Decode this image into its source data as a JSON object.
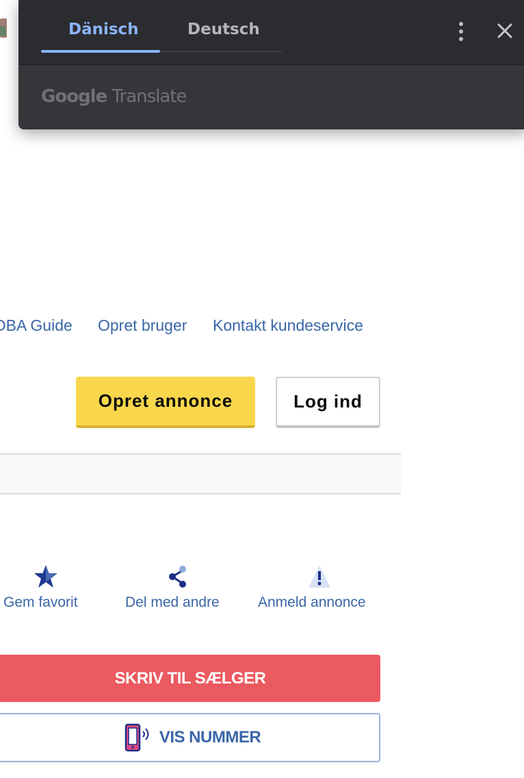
{
  "translate_popup": {
    "tabs": [
      {
        "label": "Dänisch",
        "active": true
      },
      {
        "label": "Deutsch",
        "active": false
      }
    ],
    "brand_google": "Google",
    "brand_translate": "Translate",
    "menu_icon": "more-vert-icon",
    "close_icon": "close-icon",
    "colors": {
      "background": "#35363a",
      "accent": "#8ab4f8"
    }
  },
  "top_links": [
    "DBA Guide",
    "Opret bruger",
    "Kontakt kundeservice"
  ],
  "header_buttons": {
    "create_ad": "Opret annonce",
    "login": "Log ind"
  },
  "actions": [
    {
      "label": "Gem favorit",
      "icon": "star-icon"
    },
    {
      "label": "Del med andre",
      "icon": "share-icon"
    },
    {
      "label": "Anmeld annonce",
      "icon": "warning-icon"
    }
  ],
  "contact": {
    "write_seller": "SKRIV TIL SÆLGER",
    "show_number": "VIS NUMMER",
    "phone_icon": "phone-icon"
  },
  "colors": {
    "link": "#3a66a8",
    "create_button": "#f9d74c",
    "write_button": "#eb5a60"
  }
}
